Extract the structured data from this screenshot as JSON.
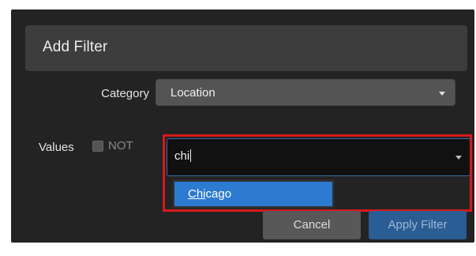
{
  "dialog": {
    "title": "Add Filter"
  },
  "category": {
    "label": "Category",
    "selected": "Location"
  },
  "values": {
    "label": "Values",
    "not_label": "NOT",
    "not_checked": false,
    "input_value": "chi"
  },
  "suggestions": [
    {
      "match": "Chi",
      "rest": "cago"
    }
  ],
  "buttons": {
    "cancel": "Cancel",
    "apply": "Apply Filter"
  },
  "colors": {
    "highlight_border": "#d7191c",
    "suggestion_active": "#2c7bd1",
    "apply_button": "#2a5d93"
  },
  "icons": {
    "dropdown": "chevron-down-icon"
  }
}
